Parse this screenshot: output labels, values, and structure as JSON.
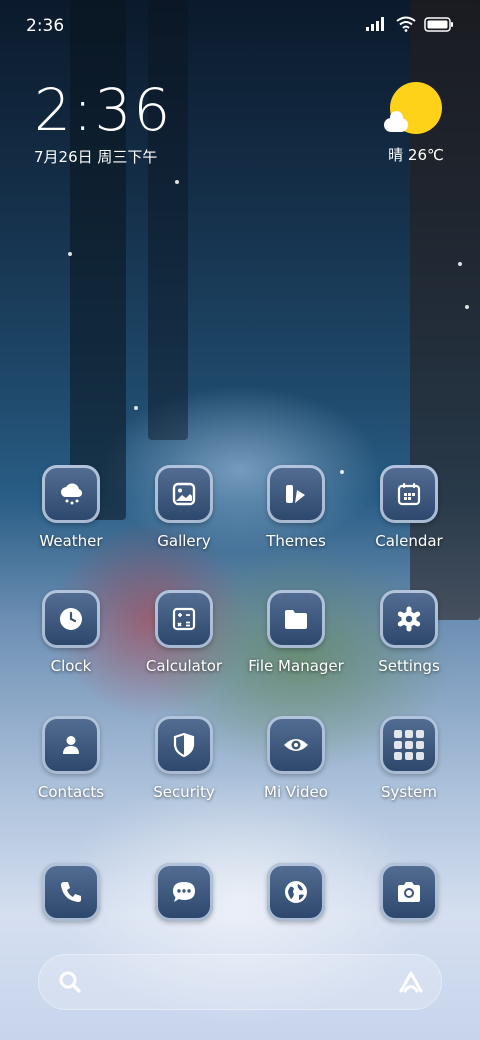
{
  "status_bar": {
    "time": "2:36",
    "icons": [
      "signal-icon",
      "wifi-icon",
      "battery-icon"
    ]
  },
  "clock_widget": {
    "time": "2:36",
    "date": "7月26日 周三下午"
  },
  "weather_widget": {
    "icon": "sunny-cloud-icon",
    "text": "晴 26℃"
  },
  "apps": [
    {
      "label": "Weather",
      "icon": "weather-icon"
    },
    {
      "label": "Gallery",
      "icon": "gallery-icon"
    },
    {
      "label": "Themes",
      "icon": "themes-icon"
    },
    {
      "label": "Calendar",
      "icon": "calendar-icon"
    },
    {
      "label": "Clock",
      "icon": "clock-icon"
    },
    {
      "label": "Calculator",
      "icon": "calculator-icon"
    },
    {
      "label": "File Manager",
      "icon": "folder-icon"
    },
    {
      "label": "Settings",
      "icon": "gear-icon"
    },
    {
      "label": "Contacts",
      "icon": "person-icon"
    },
    {
      "label": "Security",
      "icon": "shield-icon"
    },
    {
      "label": "Mi Video",
      "icon": "eye-icon"
    },
    {
      "label": "System",
      "icon": "grid-icon"
    }
  ],
  "dock": [
    {
      "name": "phone",
      "icon": "phone-icon"
    },
    {
      "name": "messages",
      "icon": "message-icon"
    },
    {
      "name": "browser",
      "icon": "globe-icon"
    },
    {
      "name": "camera",
      "icon": "camera-icon"
    }
  ],
  "search_bar": {
    "left_icon": "search-icon",
    "right_icon": "assistant-icon"
  }
}
